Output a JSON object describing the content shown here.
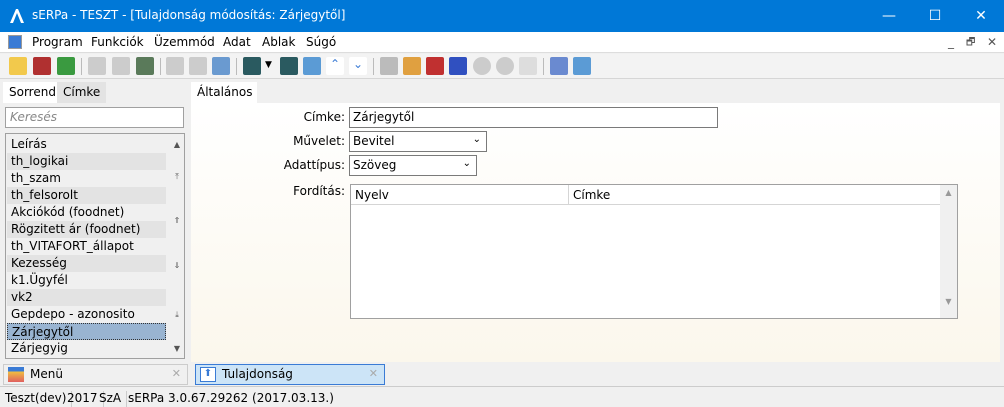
{
  "window": {
    "title": "sERPa - TESZT - [Tulajdonság módosítás: Zárjegytől]",
    "minimize": "—",
    "maximize": "☐",
    "close": "✕"
  },
  "menu": {
    "items": [
      "Program",
      "Funkciók",
      "Üzemmód",
      "Adat",
      "Ablak",
      "Súgó"
    ],
    "mdi_controls": [
      "_",
      "🗗",
      "✕"
    ]
  },
  "left": {
    "tabs": [
      "Sorrend",
      "Címke"
    ],
    "search_placeholder": "Keresés",
    "items": [
      "Leírás",
      "th_logikai",
      "th_szam",
      "th_felsorolt",
      "Akciókód (foodnet)",
      "Rögzitett ár (foodnet)",
      "th_VITAFORT_állapot",
      "Kezesség",
      "k1.Ügyfél",
      "vk2",
      "Gepdepo - azonosito",
      "Zárjegytől",
      "Zárjegyig"
    ],
    "selected": "Zárjegytől"
  },
  "form": {
    "tab": "Általános",
    "cimke_label": "Címke:",
    "cimke_value": "Zárjegytől",
    "muvelet_label": "Művelet:",
    "muvelet_value": "Bevitel",
    "adattipus_label": "Adattípus:",
    "adattipus_value": "Szöveg",
    "forditas_label": "Fordítás:",
    "columns": [
      "Nyelv",
      "Címke"
    ]
  },
  "bottom_tabs": [
    "Menü",
    "Tulajdonság"
  ],
  "status": [
    "Teszt(dev)",
    "2017",
    "SzA",
    "sERPa 3.0.67.29262 (2017.03.13.)"
  ]
}
